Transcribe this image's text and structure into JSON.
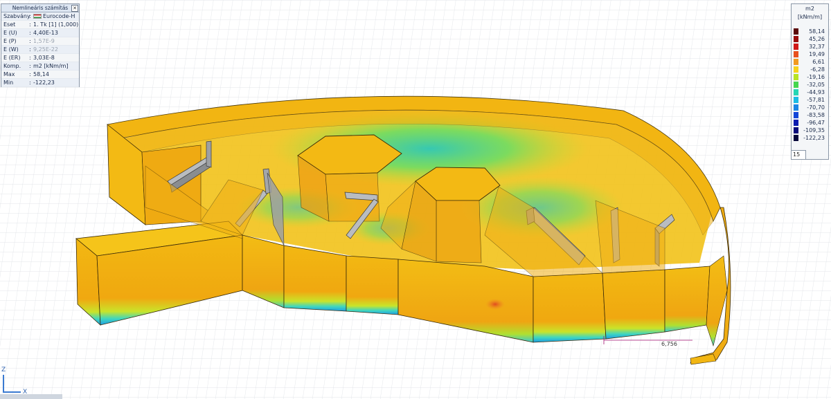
{
  "info_panel": {
    "title": "Nemlineáris számítás",
    "rows": [
      {
        "key": "Szabvány",
        "value": "Eurocode-H"
      },
      {
        "key": "Eset",
        "value": "1. Tk [1] (1,000)"
      },
      {
        "key": "E (U)",
        "value": "4,40E-13"
      },
      {
        "key": "E (P)",
        "value": "1,57E-9"
      },
      {
        "key": "E (W)",
        "value": "9,25E-22"
      },
      {
        "key": "E (ER)",
        "value": "3,03E-8"
      },
      {
        "key": "Komp.",
        "value": "m2 [kNm/m]"
      },
      {
        "key": "Max",
        "value": "58,14"
      },
      {
        "key": "Min",
        "value": "-122,23"
      }
    ]
  },
  "legend": {
    "title": "m2",
    "unit": "[kNm/m]",
    "items": [
      {
        "value": "58,14",
        "color": "#5a0a0a"
      },
      {
        "value": "45,26",
        "color": "#9a0c0c"
      },
      {
        "value": "32,37",
        "color": "#d01818"
      },
      {
        "value": "19,49",
        "color": "#e8501e"
      },
      {
        "value": "6,61",
        "color": "#f29a20"
      },
      {
        "value": "-6,28",
        "color": "#f7d21c"
      },
      {
        "value": "-19,16",
        "color": "#b8e424"
      },
      {
        "value": "-32,05",
        "color": "#46d64e"
      },
      {
        "value": "-44,93",
        "color": "#26d6b4"
      },
      {
        "value": "-57,81",
        "color": "#1cbce4"
      },
      {
        "value": "-70,70",
        "color": "#1c86e4"
      },
      {
        "value": "-83,58",
        "color": "#1446d8"
      },
      {
        "value": "-96,47",
        "color": "#0c1cb0"
      },
      {
        "value": "-109,35",
        "color": "#080c7a"
      },
      {
        "value": "-122,23",
        "color": "#04063a"
      }
    ],
    "count_value": "15"
  },
  "dimension_label": "6,756",
  "axis": {
    "z": "Z",
    "x": "X"
  }
}
